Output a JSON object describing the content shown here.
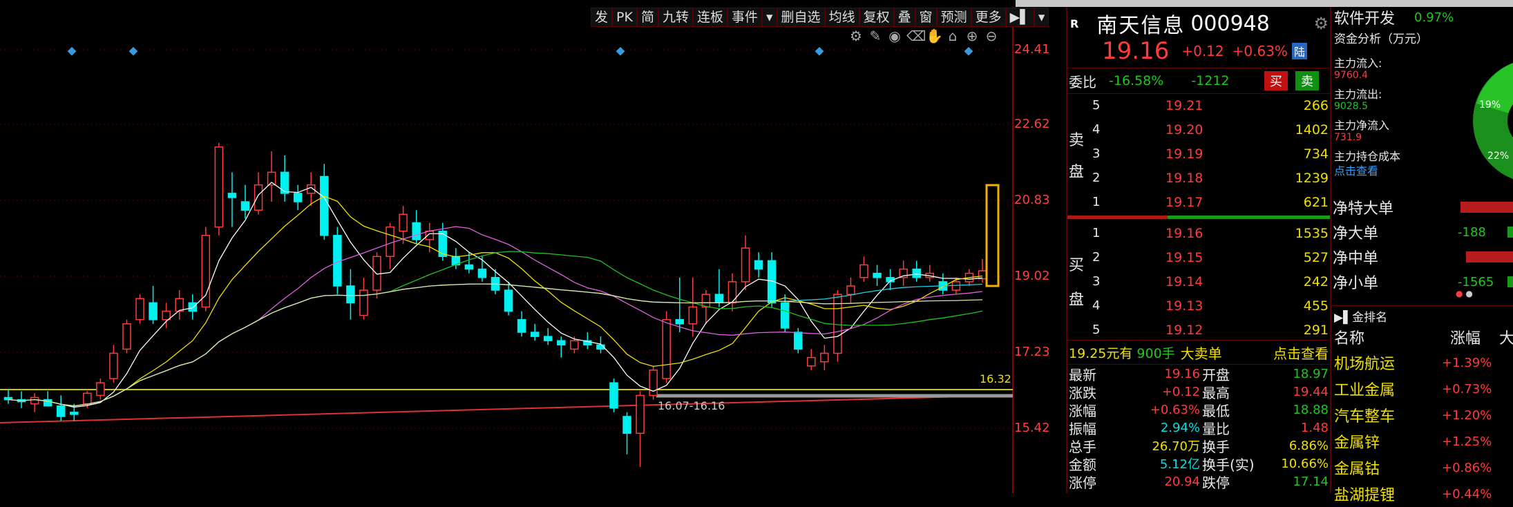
{
  "toolbar": {
    "items": [
      "发",
      "PK",
      "简",
      "九转",
      "连板",
      "事件",
      "▾",
      "删自选",
      "均线",
      "复权",
      "叠",
      "窗",
      "预测",
      "更多",
      "▶▌",
      "▾"
    ]
  },
  "price_axis": {
    "labels": [
      "24.41",
      "22.62",
      "20.83",
      "19.02",
      "17.23",
      "15.42"
    ]
  },
  "chart_annotations": {
    "high_marker": "16.32",
    "low_marker": "16.07-16.16"
  },
  "stock": {
    "badge": "R",
    "name": "南天信息",
    "code": "000948",
    "price": "19.16",
    "change": "+0.12",
    "change_pct": "+0.63%",
    "market_tag": "陆"
  },
  "order_ratio": {
    "label": "委比",
    "ratio": "-16.58%",
    "diff": "-1212",
    "buy_btn": "买",
    "sell_btn": "卖"
  },
  "sell_side": {
    "label_1": "卖",
    "label_2": "盘",
    "levels": [
      {
        "n": "5",
        "price": "19.21",
        "vol": "266"
      },
      {
        "n": "4",
        "price": "19.20",
        "vol": "1402"
      },
      {
        "n": "3",
        "price": "19.19",
        "vol": "734"
      },
      {
        "n": "2",
        "price": "19.18",
        "vol": "1239"
      },
      {
        "n": "1",
        "price": "19.17",
        "vol": "621"
      }
    ]
  },
  "buy_side": {
    "label_1": "买",
    "label_2": "盘",
    "levels": [
      {
        "n": "1",
        "price": "19.16",
        "vol": "1535"
      },
      {
        "n": "2",
        "price": "19.15",
        "vol": "527"
      },
      {
        "n": "3",
        "price": "19.14",
        "vol": "242"
      },
      {
        "n": "4",
        "price": "19.13",
        "vol": "455"
      },
      {
        "n": "5",
        "price": "19.12",
        "vol": "291"
      }
    ]
  },
  "big_order": {
    "price_text": "19.25元有",
    "qty_text": "900手",
    "label": "大卖单",
    "link": "点击查看"
  },
  "quote": {
    "rows": [
      {
        "l1": "最新",
        "v1": "19.16",
        "c1": "red",
        "l2": "开盘",
        "v2": "18.97",
        "c2": "green"
      },
      {
        "l1": "涨跌",
        "v1": "+0.12",
        "c1": "red",
        "l2": "最高",
        "v2": "19.44",
        "c2": "red"
      },
      {
        "l1": "涨幅",
        "v1": "+0.63%",
        "c1": "red",
        "l2": "最低",
        "v2": "18.88",
        "c2": "green"
      },
      {
        "l1": "振幅",
        "v1": "2.94%",
        "c1": "cyan",
        "l2": "量比",
        "v2": "1.48",
        "c2": "red"
      },
      {
        "l1": "总手",
        "v1": "26.70万",
        "c1": "yellow",
        "l2": "换手",
        "v2": "6.86%",
        "c2": "yellow"
      },
      {
        "l1": "金额",
        "v1": "5.12亿",
        "c1": "cyan",
        "l2": "换手(实)",
        "v2": "10.66%",
        "c2": "yellow"
      },
      {
        "l1": "涨停",
        "v1": "20.94",
        "c1": "red",
        "l2": "跌停",
        "v2": "17.14",
        "c2": "green"
      }
    ]
  },
  "sector": {
    "name": "软件开发",
    "pct": "0.97%"
  },
  "fund": {
    "title": "资金分析（万元）",
    "inflow_label": "主力流入:",
    "inflow": "9760.4",
    "outflow_label": "主力流出:",
    "outflow": "9028.5",
    "net_label": "主力净流入",
    "net": "731.9",
    "cost_label": "主力持仓成本",
    "cost_link": "点击查看",
    "pie_pct_1": "19%",
    "pie_pct_2": "22%"
  },
  "net_orders": [
    {
      "label": "净特大单",
      "value": ""
    },
    {
      "label": "净大单",
      "value": "-188"
    },
    {
      "label": "净中单",
      "value": ""
    },
    {
      "label": "净小单",
      "value": "-1565"
    }
  ],
  "ranking": {
    "title": "▶▌金排名",
    "col_name": "名称",
    "col_pct": "涨幅",
    "col_extra": "大",
    "rows": [
      {
        "name": "机场航运",
        "pct": "+1.39%"
      },
      {
        "name": "工业金属",
        "pct": "+0.73%"
      },
      {
        "name": "汽车整车",
        "pct": "+1.20%"
      },
      {
        "name": "金属锌",
        "pct": "+1.25%"
      },
      {
        "name": "金属钴",
        "pct": "+0.86%"
      },
      {
        "name": "盐湖提锂",
        "pct": "+0.44%"
      }
    ]
  },
  "colors": {
    "up": "#ff3b3b",
    "down": "#00f0f0",
    "bg": "#000000",
    "grid": "#5a0000"
  },
  "chart_data": {
    "type": "candlestick",
    "ylim": [
      14.6,
      25.0
    ],
    "candles": [
      {
        "o": 16.15,
        "h": 16.35,
        "l": 16.0,
        "c": 16.1
      },
      {
        "o": 16.1,
        "h": 16.3,
        "l": 15.9,
        "c": 16.05
      },
      {
        "o": 16.0,
        "h": 16.25,
        "l": 15.8,
        "c": 16.15
      },
      {
        "o": 16.1,
        "h": 16.3,
        "l": 16.0,
        "c": 15.95
      },
      {
        "o": 15.95,
        "h": 16.2,
        "l": 15.6,
        "c": 15.7
      },
      {
        "o": 15.8,
        "h": 16.0,
        "l": 15.6,
        "c": 15.75
      },
      {
        "o": 16.0,
        "h": 16.3,
        "l": 15.9,
        "c": 16.25
      },
      {
        "o": 16.2,
        "h": 16.6,
        "l": 16.1,
        "c": 16.5
      },
      {
        "o": 16.6,
        "h": 17.4,
        "l": 16.5,
        "c": 17.2
      },
      {
        "o": 17.3,
        "h": 18.0,
        "l": 17.2,
        "c": 17.9
      },
      {
        "o": 18.0,
        "h": 18.6,
        "l": 17.9,
        "c": 18.5
      },
      {
        "o": 18.4,
        "h": 18.8,
        "l": 17.9,
        "c": 18.0
      },
      {
        "o": 18.0,
        "h": 18.4,
        "l": 17.8,
        "c": 18.2
      },
      {
        "o": 18.2,
        "h": 18.7,
        "l": 18.0,
        "c": 18.5
      },
      {
        "o": 18.4,
        "h": 18.6,
        "l": 18.0,
        "c": 18.2
      },
      {
        "o": 18.3,
        "h": 20.2,
        "l": 18.2,
        "c": 20.0
      },
      {
        "o": 20.2,
        "h": 22.2,
        "l": 20.0,
        "c": 22.1
      },
      {
        "o": 21.0,
        "h": 21.5,
        "l": 20.2,
        "c": 20.9
      },
      {
        "o": 20.8,
        "h": 21.2,
        "l": 20.4,
        "c": 20.6
      },
      {
        "o": 20.6,
        "h": 21.5,
        "l": 20.5,
        "c": 21.2
      },
      {
        "o": 21.2,
        "h": 22.0,
        "l": 20.8,
        "c": 21.5
      },
      {
        "o": 21.5,
        "h": 21.9,
        "l": 20.8,
        "c": 21.0
      },
      {
        "o": 21.0,
        "h": 21.2,
        "l": 20.6,
        "c": 20.8
      },
      {
        "o": 21.0,
        "h": 21.5,
        "l": 20.7,
        "c": 21.2
      },
      {
        "o": 21.4,
        "h": 21.7,
        "l": 19.9,
        "c": 20.0
      },
      {
        "o": 20.0,
        "h": 20.2,
        "l": 18.6,
        "c": 18.8
      },
      {
        "o": 18.8,
        "h": 19.2,
        "l": 18.0,
        "c": 18.4
      },
      {
        "o": 18.1,
        "h": 19.0,
        "l": 18.0,
        "c": 18.7
      },
      {
        "o": 18.7,
        "h": 19.6,
        "l": 18.5,
        "c": 19.5
      },
      {
        "o": 19.5,
        "h": 20.3,
        "l": 19.2,
        "c": 20.2
      },
      {
        "o": 20.1,
        "h": 20.7,
        "l": 19.8,
        "c": 20.5
      },
      {
        "o": 20.3,
        "h": 20.6,
        "l": 19.8,
        "c": 19.9
      },
      {
        "o": 19.9,
        "h": 20.3,
        "l": 19.6,
        "c": 20.1
      },
      {
        "o": 20.1,
        "h": 20.3,
        "l": 19.4,
        "c": 19.5
      },
      {
        "o": 19.5,
        "h": 19.7,
        "l": 19.2,
        "c": 19.3
      },
      {
        "o": 19.3,
        "h": 19.6,
        "l": 19.1,
        "c": 19.2
      },
      {
        "o": 19.2,
        "h": 19.5,
        "l": 18.9,
        "c": 19.0
      },
      {
        "o": 19.0,
        "h": 19.2,
        "l": 18.6,
        "c": 18.7
      },
      {
        "o": 18.7,
        "h": 18.9,
        "l": 18.1,
        "c": 18.2
      },
      {
        "o": 18.0,
        "h": 18.2,
        "l": 17.6,
        "c": 17.7
      },
      {
        "o": 17.7,
        "h": 17.9,
        "l": 17.5,
        "c": 17.6
      },
      {
        "o": 17.6,
        "h": 17.8,
        "l": 17.4,
        "c": 17.5
      },
      {
        "o": 17.5,
        "h": 17.6,
        "l": 17.1,
        "c": 17.4
      },
      {
        "o": 17.3,
        "h": 17.6,
        "l": 17.2,
        "c": 17.5
      },
      {
        "o": 17.5,
        "h": 17.7,
        "l": 17.3,
        "c": 17.4
      },
      {
        "o": 17.4,
        "h": 17.6,
        "l": 17.2,
        "c": 17.3
      },
      {
        "o": 16.5,
        "h": 16.6,
        "l": 15.8,
        "c": 15.9
      },
      {
        "o": 15.7,
        "h": 15.8,
        "l": 14.8,
        "c": 15.3
      },
      {
        "o": 15.3,
        "h": 16.3,
        "l": 14.5,
        "c": 16.2
      },
      {
        "o": 16.2,
        "h": 16.9,
        "l": 16.1,
        "c": 16.8
      },
      {
        "o": 16.6,
        "h": 18.2,
        "l": 16.5,
        "c": 18.0
      },
      {
        "o": 18.0,
        "h": 19.0,
        "l": 17.7,
        "c": 17.9
      },
      {
        "o": 17.9,
        "h": 19.0,
        "l": 17.6,
        "c": 18.3
      },
      {
        "o": 18.3,
        "h": 18.7,
        "l": 17.9,
        "c": 18.6
      },
      {
        "o": 18.6,
        "h": 19.2,
        "l": 18.3,
        "c": 18.4
      },
      {
        "o": 18.4,
        "h": 19.1,
        "l": 18.2,
        "c": 18.9
      },
      {
        "o": 18.9,
        "h": 20.0,
        "l": 18.7,
        "c": 19.7
      },
      {
        "o": 19.4,
        "h": 19.6,
        "l": 19.0,
        "c": 19.2
      },
      {
        "o": 19.4,
        "h": 19.6,
        "l": 18.3,
        "c": 18.4
      },
      {
        "o": 18.4,
        "h": 18.6,
        "l": 17.7,
        "c": 17.8
      },
      {
        "o": 17.7,
        "h": 17.8,
        "l": 17.2,
        "c": 17.3
      },
      {
        "o": 16.9,
        "h": 17.3,
        "l": 16.8,
        "c": 17.1
      },
      {
        "o": 17.0,
        "h": 17.4,
        "l": 16.8,
        "c": 17.2
      },
      {
        "o": 17.2,
        "h": 18.7,
        "l": 17.0,
        "c": 18.6
      },
      {
        "o": 18.6,
        "h": 19.0,
        "l": 18.4,
        "c": 18.8
      },
      {
        "o": 19.0,
        "h": 19.5,
        "l": 18.9,
        "c": 19.3
      },
      {
        "o": 19.1,
        "h": 19.3,
        "l": 18.8,
        "c": 19.0
      },
      {
        "o": 19.0,
        "h": 19.2,
        "l": 18.7,
        "c": 18.9
      },
      {
        "o": 19.0,
        "h": 19.4,
        "l": 18.8,
        "c": 19.2
      },
      {
        "o": 19.2,
        "h": 19.4,
        "l": 18.9,
        "c": 19.0
      },
      {
        "o": 19.0,
        "h": 19.3,
        "l": 18.9,
        "c": 19.1
      },
      {
        "o": 18.9,
        "h": 19.1,
        "l": 18.6,
        "c": 18.7
      },
      {
        "o": 18.7,
        "h": 19.0,
        "l": 18.6,
        "c": 18.9
      },
      {
        "o": 18.9,
        "h": 19.2,
        "l": 18.8,
        "c": 19.1
      },
      {
        "o": 18.97,
        "h": 19.44,
        "l": 18.88,
        "c": 19.16
      }
    ]
  }
}
